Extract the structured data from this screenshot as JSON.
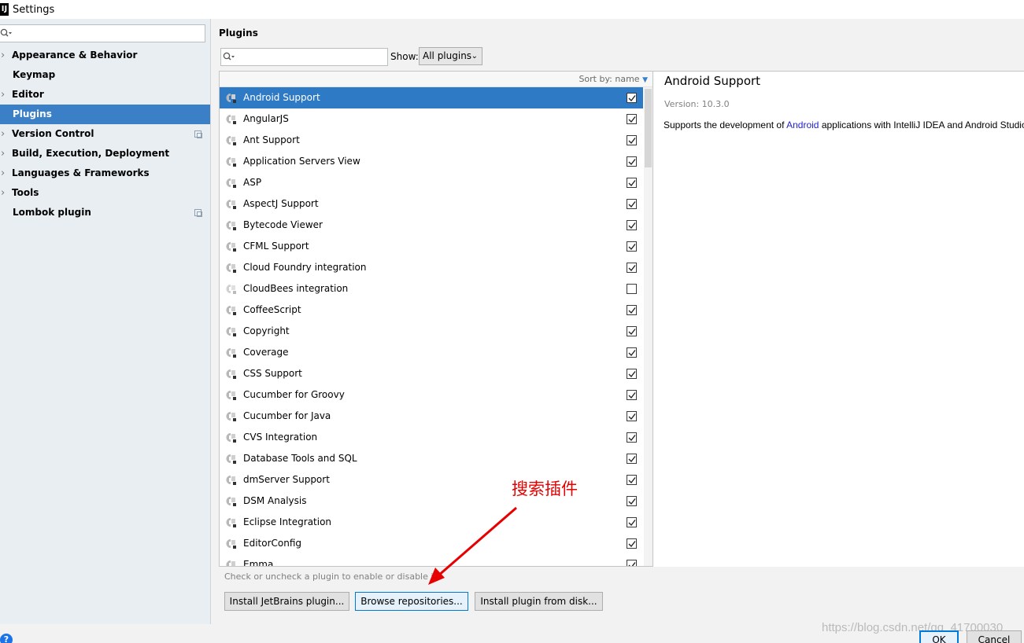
{
  "window": {
    "title": "Settings",
    "logo_text": "IJ"
  },
  "sidebar": {
    "search_placeholder": "",
    "items": [
      {
        "label": "Appearance & Behavior",
        "expandable": true
      },
      {
        "label": "Keymap",
        "expandable": false
      },
      {
        "label": "Editor",
        "expandable": true
      },
      {
        "label": "Plugins",
        "expandable": false,
        "selected": true
      },
      {
        "label": "Version Control",
        "expandable": true,
        "project_icon": true
      },
      {
        "label": "Build, Execution, Deployment",
        "expandable": true
      },
      {
        "label": "Languages & Frameworks",
        "expandable": true
      },
      {
        "label": "Tools",
        "expandable": true
      },
      {
        "label": "Lombok plugin",
        "expandable": false,
        "project_icon": true
      }
    ]
  },
  "plugins": {
    "heading": "Plugins",
    "show_label": "Show:",
    "show_value": "All plugins",
    "sort_label": "Sort by: name",
    "hint": "Check or uncheck a plugin to enable or disable it.",
    "list": [
      {
        "name": "Android Support",
        "enabled": true,
        "selected": true
      },
      {
        "name": "AngularJS",
        "enabled": true
      },
      {
        "name": "Ant Support",
        "enabled": true
      },
      {
        "name": "Application Servers View",
        "enabled": true
      },
      {
        "name": "ASP",
        "enabled": true
      },
      {
        "name": "AspectJ Support",
        "enabled": true
      },
      {
        "name": "Bytecode Viewer",
        "enabled": true
      },
      {
        "name": "CFML Support",
        "enabled": true
      },
      {
        "name": "Cloud Foundry integration",
        "enabled": true
      },
      {
        "name": "CloudBees integration",
        "enabled": false
      },
      {
        "name": "CoffeeScript",
        "enabled": true
      },
      {
        "name": "Copyright",
        "enabled": true
      },
      {
        "name": "Coverage",
        "enabled": true
      },
      {
        "name": "CSS Support",
        "enabled": true
      },
      {
        "name": "Cucumber for Groovy",
        "enabled": true
      },
      {
        "name": "Cucumber for Java",
        "enabled": true
      },
      {
        "name": "CVS Integration",
        "enabled": true
      },
      {
        "name": "Database Tools and SQL",
        "enabled": true
      },
      {
        "name": "dmServer Support",
        "enabled": true
      },
      {
        "name": "DSM Analysis",
        "enabled": true
      },
      {
        "name": "Eclipse Integration",
        "enabled": true
      },
      {
        "name": "EditorConfig",
        "enabled": true
      },
      {
        "name": "Emma",
        "enabled": true
      }
    ],
    "buttons": {
      "install_jetbrains": "Install JetBrains plugin...",
      "browse_repositories": "Browse repositories...",
      "install_from_disk": "Install plugin from disk..."
    }
  },
  "details": {
    "title": "Android Support",
    "version": "Version: 10.3.0",
    "desc_prefix": "Supports the development of ",
    "desc_link": "Android",
    "desc_suffix": " applications with IntelliJ IDEA and Android Studio."
  },
  "annotation": {
    "text": "搜索插件",
    "color": "#e60000"
  },
  "footer": {
    "ok": "OK",
    "cancel": "Cancel",
    "help": "?"
  },
  "watermark": "https://blog.csdn.net/qq_41700030",
  "colors": {
    "selection": "#2f7ac5",
    "sidebar_bg": "#e9eef3",
    "link": "#2222cc"
  }
}
